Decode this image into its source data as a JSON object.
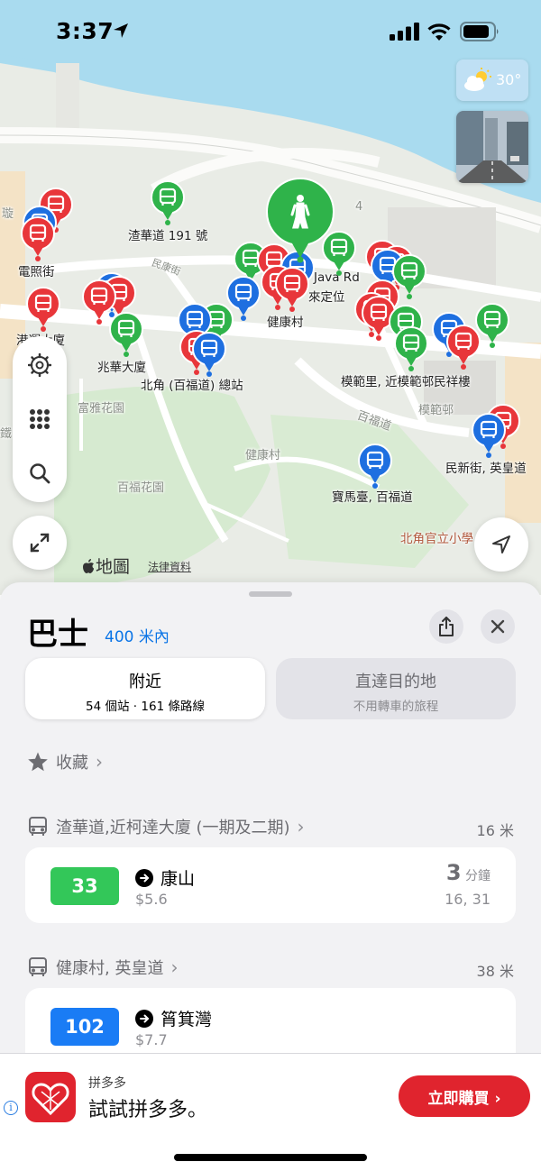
{
  "status_bar": {
    "time": "3:37",
    "icons": [
      "location-arrow-icon",
      "cellular-signal-icon",
      "wifi-icon",
      "battery-icon"
    ]
  },
  "map": {
    "weather": {
      "temp": "30°",
      "icon": "partly-cloudy-icon"
    },
    "labels": {
      "l1": "渣華道 191 號",
      "l2": "電照街",
      "l3": "港運大廈",
      "l4": "兆華大廈",
      "l5": "北角 (百福道) 總站",
      "l6": "健康村",
      "l7": "Java Rd",
      "l8": "來定位",
      "l9": "模範里, 近模範邨民祥樓",
      "l10": "富雅花園",
      "l11": "健康村",
      "l12": "百福花園",
      "l13": "百福道",
      "l14": "模範邨",
      "l15": "民新街, 英皇道",
      "l16": "寶馬臺, 百福道",
      "l17": "北角官立小學",
      "l18": "民康街",
      "l19": "璇",
      "l20": "鐵",
      "l21": "4"
    },
    "attribution": "地圖",
    "legal": "法律資料",
    "pin_colors": {
      "green": "#2fb34a",
      "red": "#e8363a",
      "blue": "#1e6fe0"
    }
  },
  "sheet": {
    "title": "巴士",
    "range": "400 米內",
    "tabs": [
      {
        "title": "附近",
        "subtitle": "54 個站 · 161 條路線"
      },
      {
        "title": "直達目的地",
        "subtitle": "不用轉車的旅程"
      }
    ],
    "favorites_label": "收藏",
    "stops": [
      {
        "name": "渣華道,近柯達大廈 (一期及二期)",
        "distance": "16 米",
        "route": {
          "number": "33",
          "color": "#33c759",
          "destination": "康山",
          "fare": "$5.6",
          "eta_value": "3",
          "eta_unit": "分鐘",
          "next": "16, 31"
        }
      },
      {
        "name": "健康村, 英皇道",
        "distance": "38 米",
        "route": {
          "number": "102",
          "color": "#1a7cf5",
          "destination": "筲箕灣",
          "fare": "$7.7"
        }
      }
    ]
  },
  "ad": {
    "brand": "拼多多",
    "text": "試試拼多多。",
    "cta": "立即購買 ›",
    "accent": "#e0242e"
  }
}
